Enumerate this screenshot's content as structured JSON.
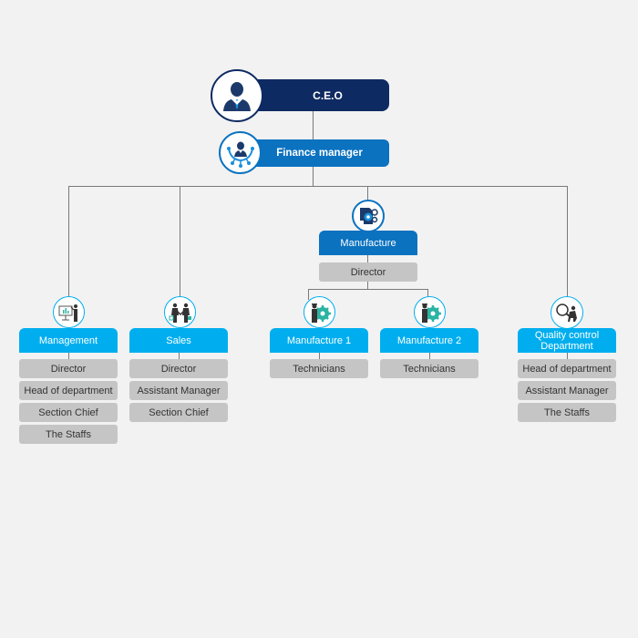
{
  "colors": {
    "background": "#f2f2f2",
    "ceo": "#0e2a62",
    "finance": "#0b72c0",
    "manufacture": "#0b72c0",
    "department": "#00aeef",
    "sub_role": "#c5c5c5",
    "connector": "#7a7a7a"
  },
  "ceo": {
    "label": "C.E.O",
    "icon": "businessman-icon"
  },
  "finance": {
    "label": "Finance manager",
    "icon": "network-manager-icon"
  },
  "manufacture": {
    "label": "Manufacture",
    "icon": "gears-head-icon",
    "roles": [
      "Director"
    ]
  },
  "departments": [
    {
      "label": "Management",
      "icon": "presentation-icon",
      "roles": [
        "Director",
        "Head of department",
        "Section Chief",
        "The Staffs"
      ]
    },
    {
      "label": "Sales",
      "icon": "handshake-icon",
      "roles": [
        "Director",
        "Assistant Manager",
        "Section Chief"
      ]
    },
    {
      "label": "Manufacture 1",
      "icon": "technician-gear-icon",
      "roles": [
        "Technicians"
      ]
    },
    {
      "label": "Manufacture 2",
      "icon": "technician-gear-icon",
      "roles": [
        "Technicians"
      ]
    },
    {
      "label": "Quality control Department",
      "icon": "magnifier-inspector-icon",
      "roles": [
        "Head of department",
        "Assistant Manager",
        "The Staffs"
      ]
    }
  ]
}
